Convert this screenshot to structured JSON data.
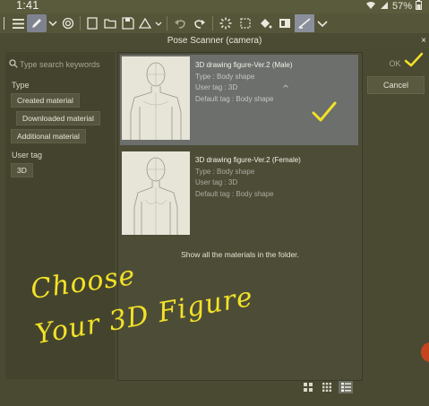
{
  "status_bar": {
    "time": "1:41",
    "battery": "57%"
  },
  "dialog": {
    "title": "Pose Scanner (camera)",
    "close": "×"
  },
  "search": {
    "placeholder": "Type search keywords"
  },
  "filters": {
    "type_label": "Type",
    "types": [
      "Created material",
      "Downloaded material",
      "Additional material"
    ],
    "user_tag_label": "User tag",
    "user_tags": [
      "3D"
    ]
  },
  "materials": [
    {
      "name": "3D drawing figure-Ver.2 (Male)",
      "type": "Type : Body shape",
      "user_tag": "User tag : 3D",
      "default_tag": "Default tag : Body shape",
      "selected": true
    },
    {
      "name": "3D drawing figure-Ver.2 (Female)",
      "type": "Type : Body shape",
      "user_tag": "User tag : 3D",
      "default_tag": "Default tag : Body shape",
      "selected": false
    }
  ],
  "show_all_label": "Show all the materials in the folder.",
  "buttons": {
    "ok": "OK",
    "cancel": "Cancel"
  },
  "annotation": {
    "line1": "Choose",
    "line2": "Your 3D Figure"
  },
  "colors": {
    "annotation": "#f2e227",
    "selection": "#6c6f6c",
    "background": "#4a4a33"
  }
}
